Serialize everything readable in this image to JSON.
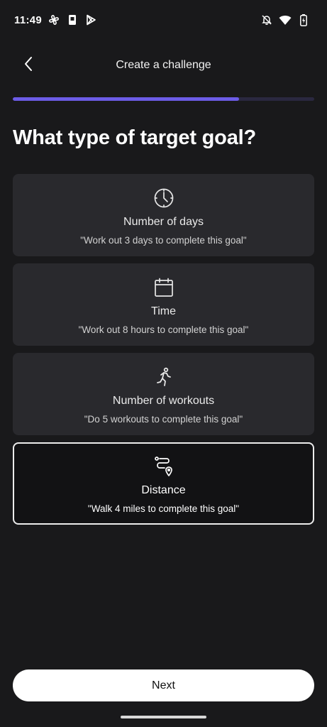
{
  "status_bar": {
    "time": "11:49",
    "icons_left": [
      "pinwheel-icon",
      "phone-notification-icon",
      "play-store-icon"
    ],
    "icons_right": [
      "notifications-off-icon",
      "wifi-icon",
      "battery-charging-icon"
    ]
  },
  "header": {
    "title": "Create a challenge",
    "back_icon": "chevron-left-icon"
  },
  "progress": {
    "value": 0.75,
    "fill_color": "#6c5ce7",
    "track_color": "#2a2840"
  },
  "question": "What type of target goal?",
  "options": [
    {
      "icon": "clock-icon",
      "title": "Number of days",
      "description": "\"Work out 3 days to complete this goal\"",
      "selected": false
    },
    {
      "icon": "calendar-icon",
      "title": "Time",
      "description": "\"Work out 8 hours to complete this goal\"",
      "selected": false
    },
    {
      "icon": "running-icon",
      "title": "Number of workouts",
      "description": "\"Do 5 workouts to complete this goal\"",
      "selected": false
    },
    {
      "icon": "route-icon",
      "title": "Distance",
      "description": "\"Walk 4 miles to complete this goal\"",
      "selected": true
    }
  ],
  "next_button": {
    "label": "Next"
  }
}
